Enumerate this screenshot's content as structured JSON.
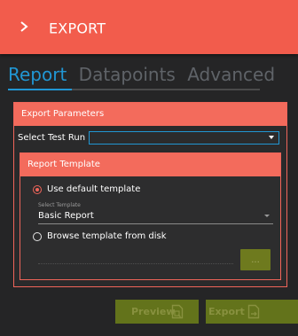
{
  "header": {
    "title": "EXPORT"
  },
  "tabs": [
    {
      "label": "Report",
      "active": true
    },
    {
      "label": "Datapoints",
      "active": false
    },
    {
      "label": "Advanced",
      "active": false
    }
  ],
  "export_parameters": {
    "title": "Export Parameters",
    "test_run_label": "Select Test Run",
    "test_run_value": ""
  },
  "report_template": {
    "title": "Report Template",
    "default_option": "Use default template",
    "select_caption": "Select Template",
    "selected_template": "Basic Report",
    "browse_option": "Browse template from disk",
    "browse_button": "..."
  },
  "footer": {
    "preview_label": "Preview",
    "export_label": "Export"
  },
  "colors": {
    "accent": "#f25c4c",
    "tab_active": "#2196d3",
    "button": "#63731b",
    "background": "#252526"
  }
}
